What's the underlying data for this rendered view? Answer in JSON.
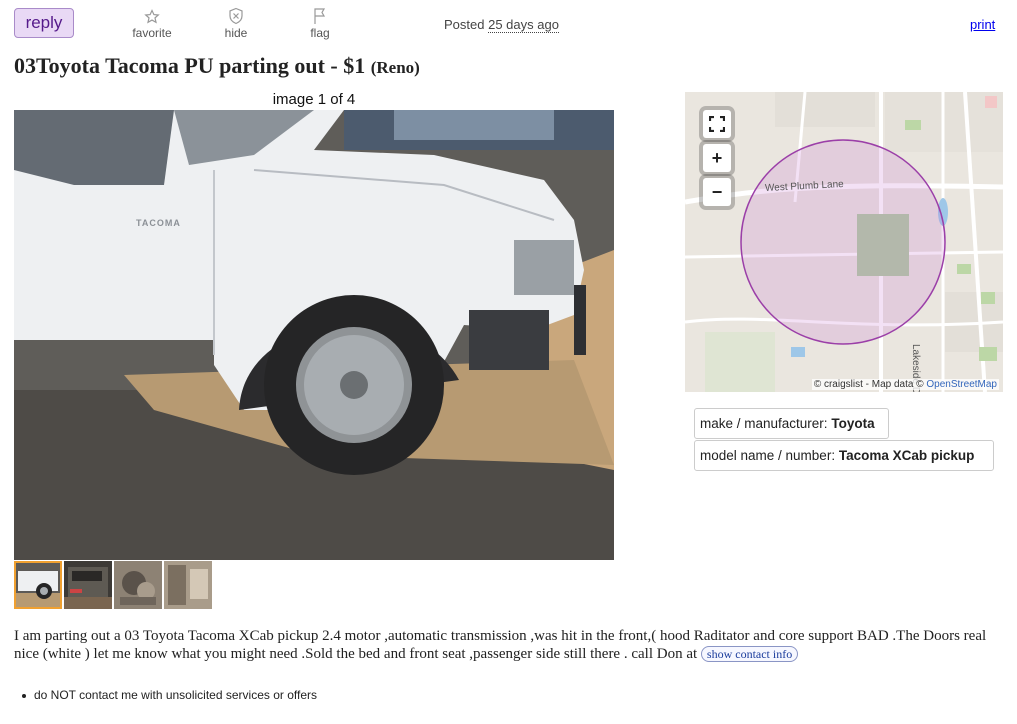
{
  "actions": {
    "reply_label": "reply",
    "favorite_label": "favorite",
    "hide_label": "hide",
    "flag_label": "flag"
  },
  "posted": {
    "prefix": "Posted",
    "time": "25 days ago"
  },
  "print_label": "print",
  "title": {
    "main": "03Toyota Tacoma PU parting out - $1",
    "location": "(Reno)"
  },
  "gallery": {
    "counter": "image 1 of 4",
    "truck_badge": "TACOMA",
    "thumbnail_count": 4,
    "selected_index": 0
  },
  "map": {
    "street_label": "West Plumb Lane",
    "side_street_label": "Lakeside D",
    "zoom_in": "+",
    "zoom_out": "−",
    "attribution_prefix": "© craigslist - Map data ©",
    "attribution_link": "OpenStreetMap"
  },
  "attributes": {
    "make_label": "make / manufacturer:",
    "make_value": "Toyota",
    "model_label": "model name / number:",
    "model_value": "Tacoma XCab pickup"
  },
  "body_text": "I am parting out a 03 Toyota Tacoma XCab pickup 2.4 motor ,automatic transmission ,was hit in the front,( hood Raditator and core support BAD .The Doors real nice (white ) let me know what you might need .Sold the bed and front seat ,passenger side still there . call Don at",
  "contact_button": "show contact info",
  "notices": [
    "do NOT contact me with unsolicited services or offers"
  ],
  "colors": {
    "reply_bg": "#e9d9f5",
    "link": "#0000ee",
    "map_circle": "#9b3fa8"
  }
}
